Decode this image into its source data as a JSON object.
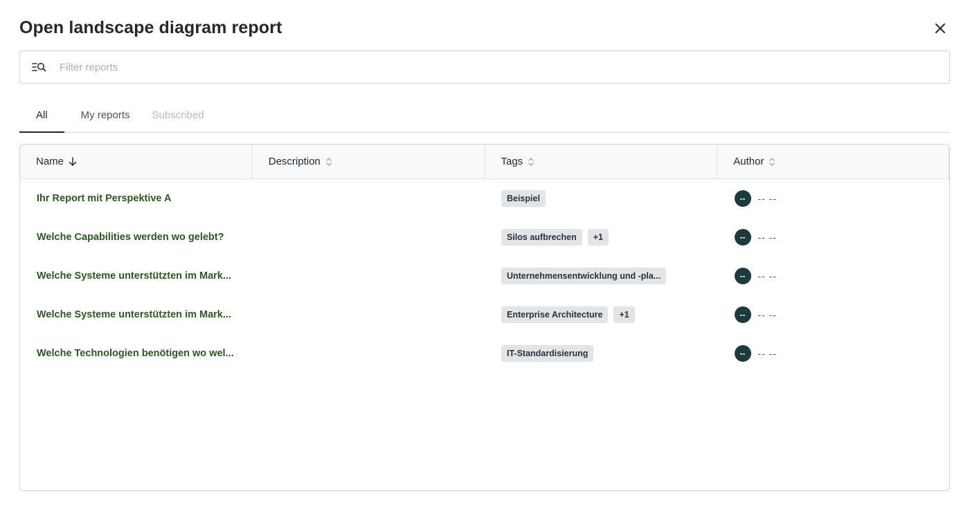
{
  "dialog": {
    "title": "Open landscape diagram report"
  },
  "search": {
    "placeholder": "Filter reports",
    "value": ""
  },
  "tabs": [
    {
      "label": "All",
      "active": true
    },
    {
      "label": "My reports",
      "active": false
    },
    {
      "label": "Subscribed",
      "active": false,
      "disabled": true
    }
  ],
  "table": {
    "columns": [
      {
        "label": "Name",
        "sort": "descending"
      },
      {
        "label": "Description",
        "sort": "none"
      },
      {
        "label": "Tags",
        "sort": "none"
      },
      {
        "label": "Author",
        "sort": "none"
      }
    ],
    "rows": [
      {
        "name": "Ihr Report mit Perspektive A",
        "description": "",
        "tags": [
          "Beispiel"
        ],
        "more": "",
        "avatar": "--",
        "author": "-- --"
      },
      {
        "name": "Welche Capabilities werden wo gelebt?",
        "description": "",
        "tags": [
          "Silos aufbrechen"
        ],
        "more": "+1",
        "avatar": "--",
        "author": "-- --"
      },
      {
        "name": "Welche Systeme unterstützten im Mark...",
        "description": "",
        "tags": [
          "Unternehmensentwicklung und -pla..."
        ],
        "more": "",
        "avatar": "--",
        "author": "-- --"
      },
      {
        "name": "Welche Systeme unterstützten im Mark...",
        "description": "",
        "tags": [
          "Enterprise Architecture"
        ],
        "more": "+1",
        "avatar": "--",
        "author": "-- --"
      },
      {
        "name": "Welche Technologien benötigen wo wel...",
        "description": "",
        "tags": [
          "IT-Standardisierung"
        ],
        "more": "",
        "avatar": "--",
        "author": "-- --"
      }
    ]
  },
  "colors": {
    "link": "#2a5a1f",
    "avatar_bg": "#1f3a3c",
    "tag_bg": "#e2e5e8"
  },
  "icons": {
    "close": "close-icon",
    "search": "filter-search-icon",
    "sort_desc": "arrow-down-icon",
    "sort_none": "sort-icon"
  }
}
